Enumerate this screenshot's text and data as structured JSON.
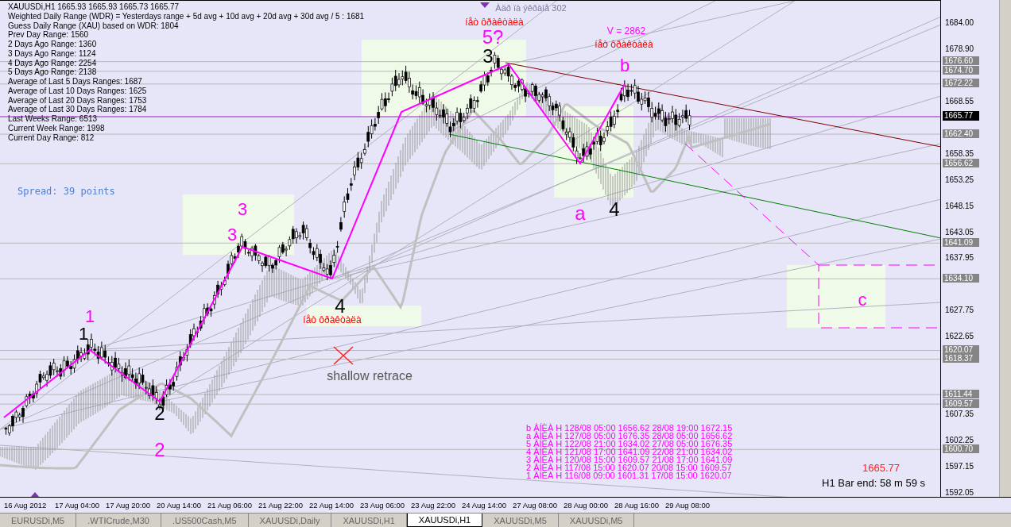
{
  "info_lines": [
    "XAUUSDi,H1  1665.93 1665.93 1665.73 1665.77",
    "Weighted Daily Range (WDR) = Yesterdays range + 5d avg + 10d avg + 20d avg + 30d avg / 5 : 1681",
    "Guess Daily Range (XAU) based on WDR: 1804",
    "Prev Day Range: 1560",
    "2 Days Ago Range: 1360",
    "3 Days Ago Range: 1124",
    "4 Days Ago Range: 2254",
    "5 Days Ago Range: 2138",
    "Average of Last 5 Days Ranges: 1687",
    "Average of Last 10 Days Ranges: 1625",
    "Average of Last 20 Days Ranges: 1753",
    "Average of Last 30 Days Ranges: 1784",
    "Last Weeks Range: 6513",
    "Current Week Range: 1998",
    "Current Day Range: 812"
  ],
  "spread": "Spread: 39 points",
  "notes": [
    {
      "text": "Àäð ïà ýêðàíå 302",
      "color": "#7a7a9e"
    },
    {
      "text": "íåò ôðàêòàëà",
      "color": "#ff0000"
    },
    {
      "text": "V = 2862",
      "color": "#ff00ff"
    },
    {
      "text": "íåò ôðàêòàëà",
      "color": "#ff0000"
    },
    {
      "text": "íåò ôðàêòàëà",
      "color": "#ff0000"
    },
    {
      "text": "shallow retrace",
      "color": "#555555"
    }
  ],
  "wave_labels": [
    {
      "text": "1",
      "color": "#ff00ff"
    },
    {
      "text": "1",
      "color": "#000000"
    },
    {
      "text": "2",
      "color": "#000000"
    },
    {
      "text": "2",
      "color": "#ff00ff"
    },
    {
      "text": "3",
      "color": "#ff00ff"
    },
    {
      "text": "3",
      "color": "#ff00ff"
    },
    {
      "text": "4",
      "color": "#000000"
    },
    {
      "text": "5?",
      "color": "#ff00ff"
    },
    {
      "text": "3",
      "color": "#000000"
    },
    {
      "text": "b",
      "color": "#ff00ff"
    },
    {
      "text": "a",
      "color": "#ff00ff"
    },
    {
      "text": "4",
      "color": "#000000"
    },
    {
      "text": "c",
      "color": "#ff00ff"
    }
  ],
  "wave_table": [
    "b ÂÍÈÀ H 128/08 05:00 1656.62 28/08 19:00 1672.15",
    "a ÂÍÈÀ H 127/08 05:00 1676.35 28/08 05:00 1656.62",
    "5 ÂÍÈÀ H 122/08 21:00 1634.02 27/08 05:00 1676.35",
    "4 ÂÍÈÀ H 121/08 17:00 1641.09 22/08 21:00 1634.02",
    "3 ÂÍÈÀ H 120/08 15:00 1609.57 21/08 17:00 1641.09",
    "2 ÂÍÈÀ H 117/08 15:00 1620.07 20/08 15:00 1609.57",
    "1 ÂÍÈÀ H 116/08 09:00 1601.31 17/08 15:00 1620.07"
  ],
  "last_price": "1665.77",
  "bar_timer": "H1 Bar end: 58 m 59 s",
  "price_axis": {
    "ticks": [
      "1684.00",
      "1678.90",
      "1668.55",
      "1658.35",
      "1653.25",
      "1648.15",
      "1643.05",
      "1637.95",
      "1627.75",
      "1622.65",
      "1607.35",
      "1602.25",
      "1597.15",
      "1592.05"
    ],
    "levels": [
      "1676.60",
      "1674.70",
      "1672.22",
      "1662.40",
      "1656.62",
      "1641.09",
      "1634.10",
      "1620.07",
      "1618.37",
      "1611.44",
      "1609.57",
      "1600.70"
    ],
    "current": "1665.77"
  },
  "time_axis": [
    "16 Aug 2012",
    "17 Aug 04:00",
    "17 Aug 20:00",
    "20 Aug 14:00",
    "21 Aug 06:00",
    "21 Aug 22:00",
    "22 Aug 14:00",
    "23 Aug 06:00",
    "23 Aug 22:00",
    "24 Aug 14:00",
    "27 Aug 08:00",
    "28 Aug 00:00",
    "28 Aug 16:00",
    "29 Aug 08:00"
  ],
  "tabs": [
    {
      "label": "EURUSDi,M5",
      "selected": false
    },
    {
      "label": ".WTICrude,M30",
      "selected": false
    },
    {
      "label": ".US500Cash,M5",
      "selected": false
    },
    {
      "label": "XAUUSDi,Daily",
      "selected": false
    },
    {
      "label": "XAUUSDi,H1",
      "selected": false
    },
    {
      "label": "XAUUSDi,H1",
      "selected": true
    },
    {
      "label": "XAUUSDi,M5",
      "selected": false
    },
    {
      "label": "XAUUSDi,M5",
      "selected": false
    }
  ]
}
